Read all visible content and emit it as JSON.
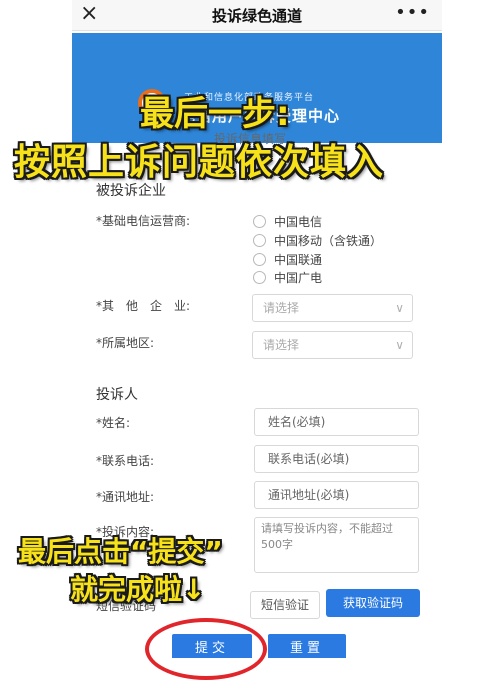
{
  "topbar": {
    "close_icon": "×",
    "title": "投诉绿色通道",
    "more_icon": "•••"
  },
  "banner": {
    "org": "工业和信息化部政务服务平台",
    "center": "电信用户申诉受理中心"
  },
  "form": {
    "header_partial": "投诉信息填写",
    "company_section": "被投诉企业",
    "carrier_label": "*基础电信运营商:",
    "carriers": [
      "中国电信",
      "中国移动（含铁通）",
      "中国联通",
      "中国广电"
    ],
    "other_label": "*其　他　企　业:",
    "other_placeholder": "请选择",
    "region_label": "*所属地区:",
    "region_placeholder": "请选择",
    "complainant_section": "投诉人",
    "name_label": "*姓名:",
    "name_placeholder": "姓名(必填)",
    "phone_label": "*联系电话:",
    "phone_placeholder": "联系电话(必填)",
    "address_label": "*通讯地址:",
    "address_placeholder": "通讯地址(必填)",
    "content_label": "*投诉内容:",
    "content_placeholder": "请填写投诉内容，不能超过500字",
    "sms_label": "短信验证码",
    "sms_placeholder": "短信验证",
    "get_code": "获取验证码",
    "submit": "提交",
    "reset": "重置"
  },
  "overlay": {
    "line1": "最后一步:",
    "line2": "按照上诉问题依次填入",
    "line3": "最后点击“提交”",
    "line4": "就完成啦↓"
  },
  "colors": {
    "banner": "#2f86d8",
    "button": "#2a7ae2",
    "overlay_text": "#f7e21a",
    "highlight_circle": "#e0262b"
  }
}
